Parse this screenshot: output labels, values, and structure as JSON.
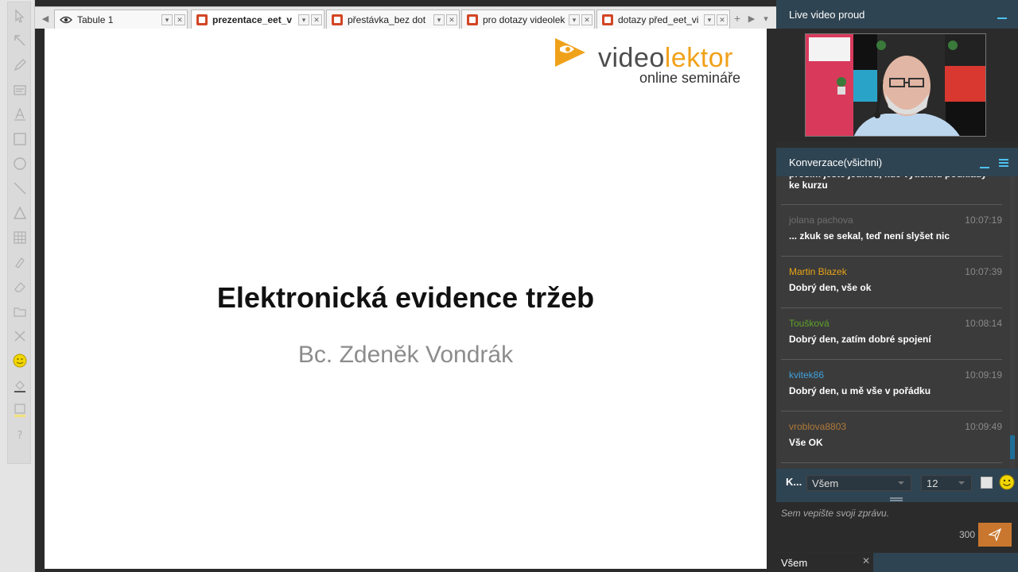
{
  "toolbar": {
    "tools": [
      "pointer-tool",
      "arrow-tool",
      "pencil-tool",
      "text-box-tool",
      "text-tool",
      "rectangle-tool",
      "ellipse-tool",
      "line-tool",
      "triangle-tool",
      "table-tool",
      "highlighter-tool",
      "eraser-tool",
      "folder-tool",
      "delete-tool",
      "smiley-tool",
      "fill-tool",
      "color-tool",
      "help-tool"
    ]
  },
  "tabs": [
    {
      "label": "Tabule 1",
      "icon": "eye-icon",
      "active": false
    },
    {
      "label": "prezentace_eet_v",
      "icon": "powerpoint-icon",
      "active": true
    },
    {
      "label": "přestávka_bez dot",
      "icon": "powerpoint-icon",
      "active": false
    },
    {
      "label": "pro dotazy videolek",
      "icon": "powerpoint-icon",
      "active": false
    },
    {
      "label": "dotazy před_eet_vi",
      "icon": "powerpoint-icon",
      "active": false
    }
  ],
  "slide": {
    "logo": {
      "word1": "video",
      "word2": "lektor",
      "subtitle": "online semináře"
    },
    "title": "Elektronická evidence tržeb",
    "author": "Bc. Zdeněk Vondrák"
  },
  "video_panel": {
    "title": "Live video proud"
  },
  "chat_panel": {
    "title": "Konverzace(všichni)",
    "partial_message": "prosím ještě jednou, kde vytisknu podklady ke kurzu",
    "messages": [
      {
        "author": "jolana pachova",
        "time": "10:07:19",
        "text": "... zkuk se sekal, teď není slyšet nic",
        "color": "#6e6e6e"
      },
      {
        "author": "Martin Blazek",
        "time": "10:07:39",
        "text": "Dobrý den, vše ok",
        "color": "#e8a317"
      },
      {
        "author": "Toušková",
        "time": "10:08:14",
        "text": "Dobrý den, zatím dobré spojení",
        "color": "#5fa32a"
      },
      {
        "author": "kvitek86",
        "time": "10:09:19",
        "text": "Dobrý den, u mě vše v pořádku",
        "color": "#3fa2db"
      },
      {
        "author": "vroblova8803",
        "time": "10:09:49",
        "text": "Vše OK",
        "color": "#b07a3a"
      }
    ]
  },
  "compose": {
    "recipient_prefix": "K...",
    "recipient_value": "Všem",
    "font_size_value": "12",
    "placeholder": "Sem vepište svoji zprávu.",
    "char_limit": "300",
    "bottom_tab_label": "Všem",
    "accent": "#c9772f"
  }
}
